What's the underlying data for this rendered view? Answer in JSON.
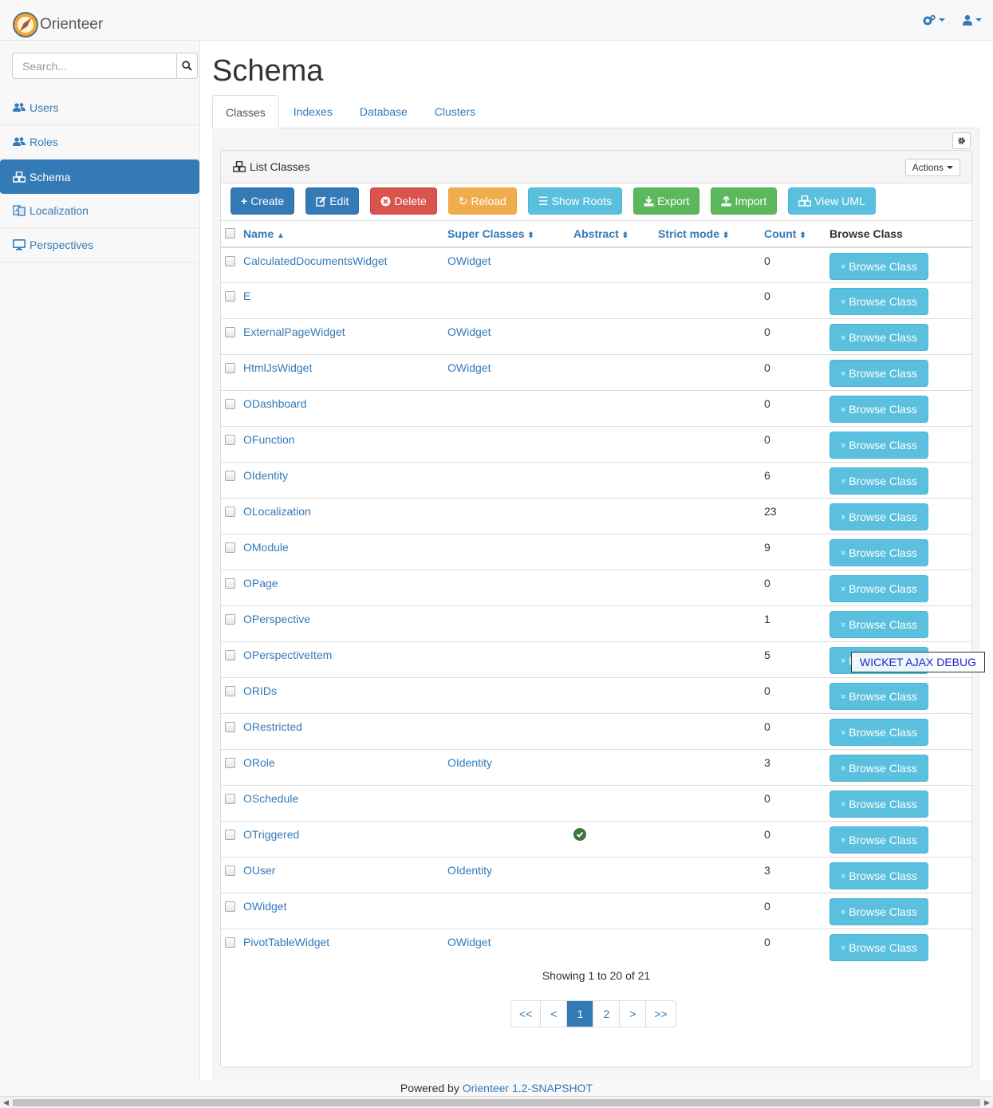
{
  "app": {
    "brand": "Orienteer"
  },
  "search": {
    "placeholder": "Search..."
  },
  "sidebar": {
    "items": [
      {
        "label": "Users",
        "icon": "users-icon"
      },
      {
        "label": "Roles",
        "icon": "users-icon"
      },
      {
        "label": "Schema",
        "icon": "cubes-icon",
        "active": true
      },
      {
        "label": "Localization",
        "icon": "language-icon"
      },
      {
        "label": "Perspectives",
        "icon": "desktop-icon"
      }
    ]
  },
  "page": {
    "title": "Schema",
    "tabs": [
      "Classes",
      "Indexes",
      "Database",
      "Clusters"
    ]
  },
  "panel": {
    "title": "List Classes",
    "actions_label": "Actions"
  },
  "toolbar": {
    "create": "Create",
    "edit": "Edit",
    "delete": "Delete",
    "reload": "Reload",
    "show_roots": "Show Roots",
    "export": "Export",
    "import": "Import",
    "view_uml": "View UML"
  },
  "table": {
    "headers": {
      "name": "Name",
      "super_classes": "Super Classes",
      "abstract": "Abstract",
      "strict_mode": "Strict mode",
      "count": "Count",
      "browse_class": "Browse Class"
    },
    "browse_label": "Browse Class",
    "rows": [
      {
        "name": "CalculatedDocumentsWidget",
        "super": "OWidget",
        "abstract": false,
        "count": "0"
      },
      {
        "name": "E",
        "super": "",
        "abstract": false,
        "count": "0"
      },
      {
        "name": "ExternalPageWidget",
        "super": "OWidget",
        "abstract": false,
        "count": "0"
      },
      {
        "name": "HtmlJsWidget",
        "super": "OWidget",
        "abstract": false,
        "count": "0"
      },
      {
        "name": "ODashboard",
        "super": "",
        "abstract": false,
        "count": "0"
      },
      {
        "name": "OFunction",
        "super": "",
        "abstract": false,
        "count": "0"
      },
      {
        "name": "OIdentity",
        "super": "",
        "abstract": false,
        "count": "6"
      },
      {
        "name": "OLocalization",
        "super": "",
        "abstract": false,
        "count": "23"
      },
      {
        "name": "OModule",
        "super": "",
        "abstract": false,
        "count": "9"
      },
      {
        "name": "OPage",
        "super": "",
        "abstract": false,
        "count": "0"
      },
      {
        "name": "OPerspective",
        "super": "",
        "abstract": false,
        "count": "1"
      },
      {
        "name": "OPerspectiveItem",
        "super": "",
        "abstract": false,
        "count": "5"
      },
      {
        "name": "ORIDs",
        "super": "",
        "abstract": false,
        "count": "0"
      },
      {
        "name": "ORestricted",
        "super": "",
        "abstract": false,
        "count": "0"
      },
      {
        "name": "ORole",
        "super": "OIdentity",
        "abstract": false,
        "count": "3"
      },
      {
        "name": "OSchedule",
        "super": "",
        "abstract": false,
        "count": "0"
      },
      {
        "name": "OTriggered",
        "super": "",
        "abstract": true,
        "count": "0"
      },
      {
        "name": "OUser",
        "super": "OIdentity",
        "abstract": false,
        "count": "3"
      },
      {
        "name": "OWidget",
        "super": "",
        "abstract": false,
        "count": "0"
      },
      {
        "name": "PivotTableWidget",
        "super": "OWidget",
        "abstract": false,
        "count": "0"
      }
    ]
  },
  "pagination": {
    "showing": "Showing 1 to 20 of 21",
    "pages": [
      "<<",
      "<",
      "1",
      "2",
      ">",
      ">>"
    ],
    "active": "1"
  },
  "debug": {
    "label": "WICKET AJAX DEBUG"
  },
  "footer": {
    "prefix": "Powered by",
    "link": "Orienteer 1.2-SNAPSHOT"
  },
  "colors": {
    "primary": "#337ab7",
    "info": "#5bc0de",
    "danger": "#d9534f",
    "warning": "#f0ad4e",
    "success": "#5cb85c"
  }
}
